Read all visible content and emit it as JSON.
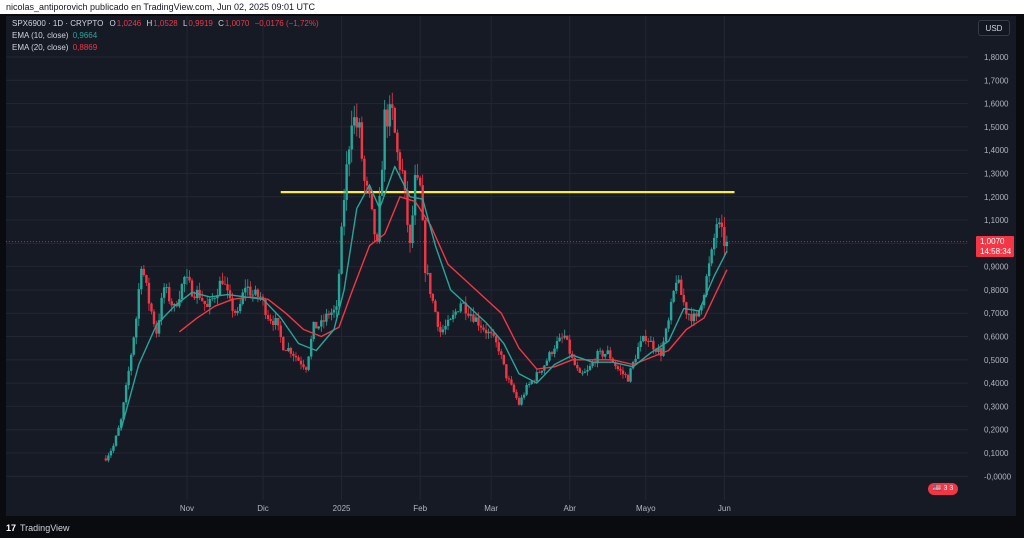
{
  "header": {
    "text": "nicolas_antiporovich publicado en TradingView.com, Jun 02, 2025 09:01 UTC"
  },
  "legend": {
    "symbol": "SPX6900 · 1D · CRYPTO",
    "o_label": "O",
    "o_value": "1,0246",
    "h_label": "H",
    "h_value": "1,0528",
    "l_label": "L",
    "l_value": "0,9919",
    "c_label": "C",
    "c_value": "1,0070",
    "change": "−0,0176 (−1,72%)",
    "ema10_label": "EMA (10, close)",
    "ema10_value": "0,9664",
    "ema20_label": "EMA (20, close)",
    "ema20_value": "0,8869"
  },
  "currency_button": "USD",
  "price_badge": {
    "price": "1,0070",
    "countdown": "14:58:34"
  },
  "events_badge": "🇺🇸 3 3",
  "footer": {
    "brand": "TradingView",
    "logo_mark": "17"
  },
  "colors": {
    "up": "#26a69a",
    "down": "#f23645",
    "ema10": "#26a69a",
    "ema20": "#f23645",
    "level": "#ffeb3b"
  },
  "chart_data": {
    "type": "candlestick",
    "symbol": "SPX6900",
    "timeframe": "1D",
    "y_ticks": [
      "1,8000",
      "1,7000",
      "1,6000",
      "1,5000",
      "1,4000",
      "1,3000",
      "1,2000",
      "1,1000",
      "1,0000",
      "0,9000",
      "0,8000",
      "0,7000",
      "0,6000",
      "0,5000",
      "0,4000",
      "0,3000",
      "0,2000",
      "0,1000",
      "-0,0000"
    ],
    "y_tick_values": [
      1.8,
      1.7,
      1.6,
      1.5,
      1.4,
      1.3,
      1.2,
      1.1,
      1.0,
      0.9,
      0.8,
      0.7,
      0.6,
      0.5,
      0.4,
      0.3,
      0.2,
      0.1,
      0.0
    ],
    "ylim": [
      -0.05,
      1.93
    ],
    "x_ticks": [
      "Nov",
      "Dic",
      "2025",
      "Feb",
      "Mar",
      "Abr",
      "Mayo",
      "Jun"
    ],
    "x_tick_dates": [
      "2024-11-01",
      "2024-12-01",
      "2025-01-01",
      "2025-02-01",
      "2025-03-01",
      "2025-04-01",
      "2025-05-01",
      "2025-06-01"
    ],
    "start_date": "2024-09-30",
    "end_date": "2025-06-02",
    "horizontal_level": {
      "value": 1.22,
      "from": "2024-12-08",
      "to": "2025-06-05"
    },
    "last_price": 1.007,
    "close_path": [
      [
        "2024-09-30",
        0.08
      ],
      [
        "2024-10-03",
        0.13
      ],
      [
        "2024-10-06",
        0.24
      ],
      [
        "2024-10-09",
        0.45
      ],
      [
        "2024-10-12",
        0.68
      ],
      [
        "2024-10-14",
        0.92
      ],
      [
        "2024-10-17",
        0.75
      ],
      [
        "2024-10-20",
        0.62
      ],
      [
        "2024-10-23",
        0.81
      ],
      [
        "2024-10-27",
        0.72
      ],
      [
        "2024-10-31",
        0.85
      ],
      [
        "2024-11-03",
        0.8
      ],
      [
        "2024-11-06",
        0.78
      ],
      [
        "2024-11-09",
        0.72
      ],
      [
        "2024-11-12",
        0.78
      ],
      [
        "2024-11-15",
        0.85
      ],
      [
        "2024-11-18",
        0.74
      ],
      [
        "2024-11-21",
        0.69
      ],
      [
        "2024-11-24",
        0.82
      ],
      [
        "2024-11-27",
        0.78
      ],
      [
        "2024-11-30",
        0.77
      ],
      [
        "2024-12-03",
        0.69
      ],
      [
        "2024-12-06",
        0.66
      ],
      [
        "2024-12-09",
        0.56
      ],
      [
        "2024-12-12",
        0.54
      ],
      [
        "2024-12-15",
        0.5
      ],
      [
        "2024-12-18",
        0.47
      ],
      [
        "2024-12-21",
        0.64
      ],
      [
        "2024-12-24",
        0.65
      ],
      [
        "2024-12-27",
        0.7
      ],
      [
        "2024-12-30",
        0.71
      ],
      [
        "2025-01-02",
        1.2
      ],
      [
        "2025-01-05",
        1.55
      ],
      [
        "2025-01-08",
        1.48
      ],
      [
        "2025-01-10",
        1.26
      ],
      [
        "2025-01-12",
        1.18
      ],
      [
        "2025-01-15",
        0.98
      ],
      [
        "2025-01-18",
        1.54
      ],
      [
        "2025-01-21",
        1.55
      ],
      [
        "2025-01-23",
        1.38
      ],
      [
        "2025-01-25",
        1.3
      ],
      [
        "2025-01-28",
        0.98
      ],
      [
        "2025-01-30",
        1.26
      ],
      [
        "2025-02-01",
        1.23
      ],
      [
        "2025-02-03",
        0.9
      ],
      [
        "2025-02-06",
        0.75
      ],
      [
        "2025-02-09",
        0.62
      ],
      [
        "2025-02-13",
        0.66
      ],
      [
        "2025-02-17",
        0.75
      ],
      [
        "2025-02-21",
        0.7
      ],
      [
        "2025-02-25",
        0.65
      ],
      [
        "2025-03-01",
        0.6
      ],
      [
        "2025-03-04",
        0.55
      ],
      [
        "2025-03-07",
        0.43
      ],
      [
        "2025-03-10",
        0.36
      ],
      [
        "2025-03-12",
        0.31
      ],
      [
        "2025-03-15",
        0.38
      ],
      [
        "2025-03-18",
        0.42
      ],
      [
        "2025-03-22",
        0.48
      ],
      [
        "2025-03-26",
        0.56
      ],
      [
        "2025-03-30",
        0.6
      ],
      [
        "2025-04-02",
        0.5
      ],
      [
        "2025-04-05",
        0.43
      ],
      [
        "2025-04-08",
        0.45
      ],
      [
        "2025-04-12",
        0.52
      ],
      [
        "2025-04-16",
        0.53
      ],
      [
        "2025-04-20",
        0.46
      ],
      [
        "2025-04-24",
        0.42
      ],
      [
        "2025-04-28",
        0.55
      ],
      [
        "2025-05-01",
        0.6
      ],
      [
        "2025-05-04",
        0.56
      ],
      [
        "2025-05-07",
        0.53
      ],
      [
        "2025-05-10",
        0.66
      ],
      [
        "2025-05-13",
        0.85
      ],
      [
        "2025-05-17",
        0.71
      ],
      [
        "2025-05-21",
        0.67
      ],
      [
        "2025-05-24",
        0.8
      ],
      [
        "2025-05-27",
        0.95
      ],
      [
        "2025-05-29",
        1.09
      ],
      [
        "2025-06-01",
        1.007
      ],
      [
        "2025-06-02",
        1.007
      ]
    ],
    "ema10_path": [
      [
        "2024-10-06",
        0.2
      ],
      [
        "2024-10-13",
        0.48
      ],
      [
        "2024-10-20",
        0.65
      ],
      [
        "2024-10-27",
        0.73
      ],
      [
        "2024-11-03",
        0.79
      ],
      [
        "2024-11-10",
        0.77
      ],
      [
        "2024-11-17",
        0.78
      ],
      [
        "2024-11-24",
        0.77
      ],
      [
        "2024-12-01",
        0.76
      ],
      [
        "2024-12-08",
        0.68
      ],
      [
        "2024-12-15",
        0.57
      ],
      [
        "2024-12-22",
        0.54
      ],
      [
        "2024-12-29",
        0.63
      ],
      [
        "2025-01-02",
        0.8
      ],
      [
        "2025-01-07",
        1.15
      ],
      [
        "2025-01-12",
        1.25
      ],
      [
        "2025-01-16",
        1.15
      ],
      [
        "2025-01-22",
        1.33
      ],
      [
        "2025-01-28",
        1.2
      ],
      [
        "2025-02-02",
        1.19
      ],
      [
        "2025-02-07",
        0.99
      ],
      [
        "2025-02-13",
        0.8
      ],
      [
        "2025-02-20",
        0.73
      ],
      [
        "2025-02-27",
        0.66
      ],
      [
        "2025-03-06",
        0.57
      ],
      [
        "2025-03-12",
        0.44
      ],
      [
        "2025-03-19",
        0.4
      ],
      [
        "2025-03-26",
        0.48
      ],
      [
        "2025-04-02",
        0.52
      ],
      [
        "2025-04-10",
        0.49
      ],
      [
        "2025-04-18",
        0.49
      ],
      [
        "2025-04-26",
        0.47
      ],
      [
        "2025-05-03",
        0.53
      ],
      [
        "2025-05-10",
        0.58
      ],
      [
        "2025-05-16",
        0.72
      ],
      [
        "2025-05-22",
        0.71
      ],
      [
        "2025-05-28",
        0.86
      ],
      [
        "2025-06-02",
        0.9664
      ]
    ],
    "ema20_path": [
      [
        "2024-10-29",
        0.62
      ],
      [
        "2024-11-05",
        0.68
      ],
      [
        "2024-11-12",
        0.73
      ],
      [
        "2024-11-19",
        0.76
      ],
      [
        "2024-11-26",
        0.77
      ],
      [
        "2024-12-03",
        0.76
      ],
      [
        "2024-12-10",
        0.7
      ],
      [
        "2024-12-17",
        0.63
      ],
      [
        "2024-12-24",
        0.6
      ],
      [
        "2024-12-31",
        0.64
      ],
      [
        "2025-01-05",
        0.79
      ],
      [
        "2025-01-12",
        0.99
      ],
      [
        "2025-01-18",
        1.04
      ],
      [
        "2025-01-24",
        1.2
      ],
      [
        "2025-01-30",
        1.18
      ],
      [
        "2025-02-05",
        1.08
      ],
      [
        "2025-02-12",
        0.91
      ],
      [
        "2025-02-19",
        0.84
      ],
      [
        "2025-02-26",
        0.77
      ],
      [
        "2025-03-05",
        0.7
      ],
      [
        "2025-03-12",
        0.55
      ],
      [
        "2025-03-19",
        0.46
      ],
      [
        "2025-03-26",
        0.47
      ],
      [
        "2025-04-02",
        0.5
      ],
      [
        "2025-04-10",
        0.5
      ],
      [
        "2025-04-18",
        0.5
      ],
      [
        "2025-04-26",
        0.48
      ],
      [
        "2025-05-03",
        0.51
      ],
      [
        "2025-05-10",
        0.54
      ],
      [
        "2025-05-17",
        0.63
      ],
      [
        "2025-05-24",
        0.68
      ],
      [
        "2025-06-02",
        0.8869
      ]
    ]
  }
}
